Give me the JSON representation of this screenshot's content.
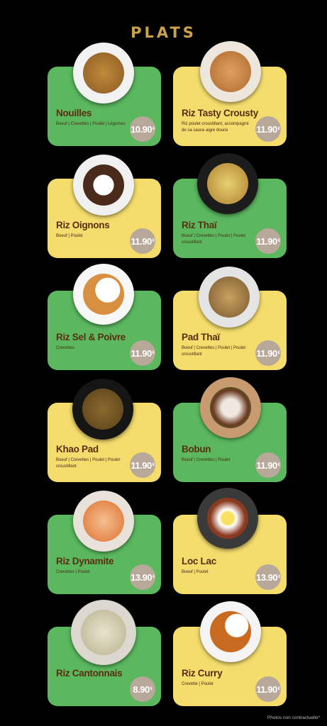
{
  "header": {
    "title": "PLATS"
  },
  "items": [
    {
      "name": "Nouilles",
      "desc": "Boeuf | Crevettes | Poulet | Légumes",
      "price": "10.90",
      "cents_mark": "€"
    },
    {
      "name": "Riz Tasty Crousty",
      "desc": "Riz poulet croustillant, accompagné de sa sauce aigre douce",
      "price": "11.90",
      "cents_mark": "€"
    },
    {
      "name": "Riz  Oignons",
      "desc": "Boeuf | Poulet",
      "price": "11.90",
      "cents_mark": "€"
    },
    {
      "name": "Riz Thaï",
      "desc": "Boeuf | Crevettes | Poulet | Poulet croustillant",
      "price": "11.90",
      "cents_mark": "€"
    },
    {
      "name": "Riz Sel & Poivre",
      "desc": "Crevettes",
      "price": "11.90",
      "cents_mark": "€"
    },
    {
      "name": "Pad Thaï",
      "desc": "Boeuf | Crevettes | Poulet | Poulet croustillant",
      "price": "11.90",
      "cents_mark": "€"
    },
    {
      "name": "Khao Pad",
      "desc": "Boeuf | Crevettes | Poulet | Poulet croustillant",
      "price": "11.90",
      "cents_mark": "€"
    },
    {
      "name": "Bobun",
      "desc": "Boeuf | Crevettes | Poulet",
      "price": "11.90",
      "cents_mark": "€"
    },
    {
      "name": "Riz Dynamite",
      "desc": "Crevettes | Poulet",
      "price": "13.90",
      "cents_mark": "€"
    },
    {
      "name": "Loc Lac",
      "desc": "Boeuf | Poulet",
      "price": "13.90",
      "cents_mark": "€"
    },
    {
      "name": "Riz Cantonnais",
      "desc": "",
      "price": "8.90",
      "cents_mark": "€"
    },
    {
      "name": "Riz Curry",
      "desc": "Crevette | Poulet",
      "price": "11.90",
      "cents_mark": "€"
    }
  ],
  "footer": {
    "note": "Photos non contractuelle*"
  },
  "colors": {
    "green_card": "#5bb85f",
    "yellow_card": "#f4dc6d",
    "price_badge": "#b8a89a",
    "title_gold": "#cda24c"
  }
}
